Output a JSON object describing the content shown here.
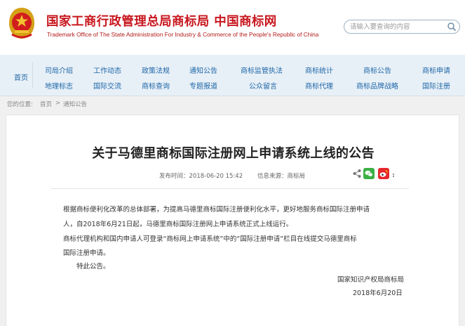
{
  "header": {
    "title": "国家工商行政管理总局商标局  中国商标网",
    "subtitle": "Trademark Office of The State Administration For Industry & Commerce of the People's Republic of China",
    "search_placeholder": "请输入要查询的内容"
  },
  "nav": {
    "home": "首页",
    "row1": [
      "司局介绍",
      "工作动态",
      "政策法规",
      "通知公告",
      "商标监管执法",
      "商标统计",
      "商标公告",
      "商标申请"
    ],
    "row2": [
      "地理标志",
      "国际交流",
      "商标查询",
      "专题报道",
      "公众留言",
      "商标代理",
      "商标品牌战略",
      "国际注册"
    ]
  },
  "breadcrumb": {
    "label": "您的位置:",
    "home": "首页",
    "separator": ">",
    "current": "通知公告"
  },
  "article": {
    "title": "关于马德里商标国际注册网上申请系统上线的公告",
    "publish_time": "发布时间：2018-06-20 15:42",
    "source": "信息来源：商标局",
    "paragraphs": [
      "根据商标便利化改革的总体部署，为提高马德里商标国际注册便利化水平，更好地服务商标国际注册申请",
      "人，自2018年6月21日起，马德里商标国际注册网上申请系统正式上线运行。",
      "商标代理机构和国内申请人可登录“商标网上申请系统”中的“国际注册申请”栏目在线提交马德里商标",
      "国际注册申请。",
      "特此公告。"
    ],
    "signature": "国家知识产权局商标局",
    "date": "2018年6月20日"
  },
  "colors": {
    "brand_red": "#c8171e",
    "nav_blue": "#1f67a8",
    "wechat_green": "#3bb044",
    "weibo_red": "#e6262c"
  }
}
